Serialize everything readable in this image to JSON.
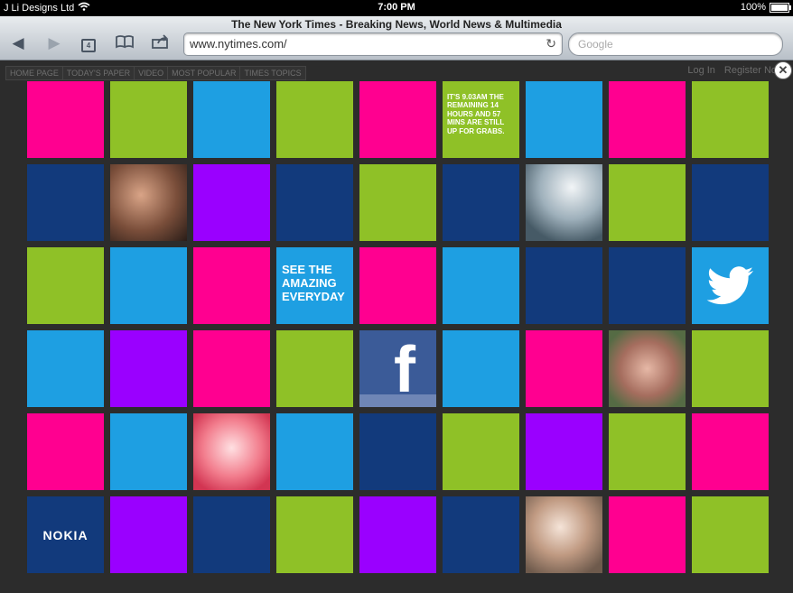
{
  "status_bar": {
    "carrier": "J Li Designs Ltd",
    "time": "7:00 PM",
    "battery": "100%"
  },
  "browser": {
    "page_title": "The New York Times - Breaking News, World News & Multimedia",
    "url": "www.nytimes.com/",
    "search_placeholder": "Google",
    "tab_count": "4"
  },
  "site_nav": {
    "items": [
      "HOME PAGE",
      "TODAY'S PAPER",
      "VIDEO",
      "MOST POPULAR",
      "TIMES TOPICS"
    ],
    "login": "Log In",
    "register": "Register No"
  },
  "ad": {
    "countdown_text": "IT'S 9.03AM THE REMAINING 14 HOURS AND 57 MINS ARE STILL UP FOR GRABS.",
    "tagline": "SEE THE AMAZING EVERYDAY",
    "brand": "NOKIA",
    "colors": {
      "pink": "#ff0090",
      "lime": "#8fc127",
      "sky": "#1e9fe2",
      "navy": "#123a7c",
      "purple": "#9a00ff"
    }
  }
}
